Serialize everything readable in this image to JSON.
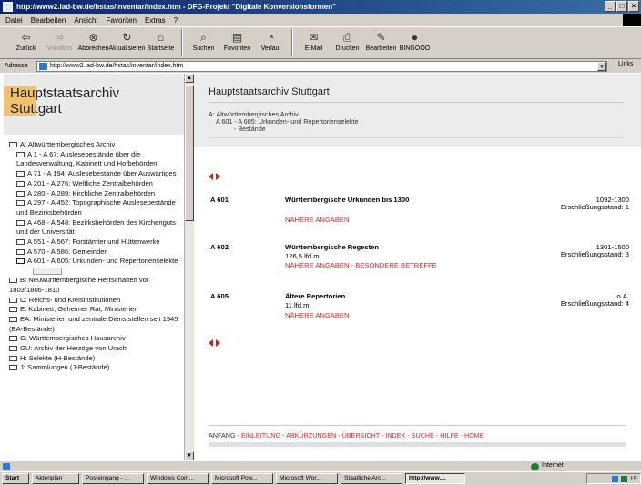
{
  "window": {
    "title": "http://www2.lad-bw.de/hstas/inventar/index.htm - DFG-Projekt \"Digitale Konversionsformen\"",
    "buttons": [
      "_",
      "□",
      "×"
    ]
  },
  "menu": [
    "Datei",
    "Bearbeiten",
    "Ansicht",
    "Favoriten",
    "Extras",
    "?"
  ],
  "toolbar": {
    "buttons": [
      {
        "label": "Zurück",
        "icon": "back-arrow-icon",
        "glyph": "⇦",
        "enabled": true
      },
      {
        "label": "Vorwärts",
        "icon": "forward-arrow-icon",
        "glyph": "⇨",
        "enabled": false
      },
      {
        "label": "Abbrechen",
        "icon": "stop-icon",
        "glyph": "⊗",
        "enabled": true
      },
      {
        "label": "Aktualisieren",
        "icon": "refresh-icon",
        "glyph": "↻",
        "enabled": true
      },
      {
        "label": "Startseite",
        "icon": "home-icon",
        "glyph": "⌂",
        "enabled": true
      },
      {
        "label": "Suchen",
        "icon": "search-icon",
        "glyph": "⌕",
        "enabled": true
      },
      {
        "label": "Favoriten",
        "icon": "favorites-icon",
        "glyph": "▤",
        "enabled": true
      },
      {
        "label": "Verlauf",
        "icon": "history-icon",
        "glyph": "◔",
        "enabled": true
      },
      {
        "label": "E-Mail",
        "icon": "mail-icon",
        "glyph": "✉",
        "enabled": true
      },
      {
        "label": "Drucken",
        "icon": "print-icon",
        "glyph": "⎙",
        "enabled": true
      },
      {
        "label": "Bearbeiten",
        "icon": "edit-icon",
        "glyph": "✎",
        "enabled": true
      },
      {
        "label": "BINGOOO",
        "icon": "bingooo-icon",
        "glyph": "●",
        "enabled": true
      }
    ]
  },
  "address": {
    "label": "Adresse",
    "url": "http://www2.lad-bw.de/hstas/inventar/index.htm",
    "links": "Links"
  },
  "left": {
    "banner": [
      "Hauptstaatsarchiv",
      "Stuttgart"
    ],
    "tree": [
      {
        "label": "A: Altwürttembergisches Archiv",
        "level": 0,
        "open": false
      },
      {
        "label": "A 1 - A 67: Auslesebestände über die Landesverwaltung, Kabinett und Hofbehörden",
        "level": 1,
        "open": false
      },
      {
        "label": "A 71 - A 194: Auslesebestände über Auswärtiges",
        "level": 1,
        "open": false
      },
      {
        "label": "A 201 - A 276: Weltliche Zentralbehörden",
        "level": 1,
        "open": false
      },
      {
        "label": "A 280 - A 289: Kirchliche Zentralbehörden",
        "level": 1,
        "open": false
      },
      {
        "label": "A 297 - A 452: Topographische Auslesebestände und Bezirksbehörden",
        "level": 1,
        "open": false
      },
      {
        "label": "A 468 - A 548: Bezirksbehörden des Kirchenguts und der Universität",
        "level": 1,
        "open": false
      },
      {
        "label": "A 551 - A 567: Forstämter und Hüttenwerke",
        "level": 1,
        "open": false
      },
      {
        "label": "A 570 - A 586: Gemeinden",
        "level": 1,
        "open": false
      },
      {
        "label": "A 601 - A 605: Urkunden- und Repertorienselekte",
        "level": 1,
        "open": true
      },
      {
        "label": "B: Neuwürttembergische Herrschaften vor 1803/1806-1810",
        "level": 0,
        "open": false
      },
      {
        "label": "C: Reichs- und Kreisinstitutionen",
        "level": 0,
        "open": false
      },
      {
        "label": "E: Kabinett, Geheimer Rat, Ministerien",
        "level": 0,
        "open": false
      },
      {
        "label": "EA: Ministerien und zentrale Dienststellen seit 1945 (EA-Bestände)",
        "level": 0,
        "open": false
      },
      {
        "label": "G: Württembergisches Hausarchiv",
        "level": 0,
        "open": false
      },
      {
        "label": "GU: Archiv der Herzöge von Urach",
        "level": 0,
        "open": false
      },
      {
        "label": "H: Selekte (H-Bestände)",
        "level": 0,
        "open": false
      },
      {
        "label": "J: Sammlungen (J-Bestände)",
        "level": 0,
        "open": false
      }
    ]
  },
  "right": {
    "title": "Hauptstaatsarchiv Stuttgart",
    "breadcrumb": [
      "A: Altwürttembergisches Archiv",
      "A 601 - A 605: Urkunden- und Repertorienselekte",
      "- Bestände"
    ],
    "records": [
      {
        "sig": "A 601",
        "title": "Württembergische Urkunden bis 1300",
        "extent": "",
        "links": "NÄHERE ANGABEN",
        "dates": "1092-1300",
        "state": "Erschließungsstand: 1"
      },
      {
        "sig": "A 602",
        "title": "Württembergische Regesten",
        "extent": "126,5 lfd.m",
        "links": "NÄHERE ANGABEN - BESONDERE BETREFFE",
        "dates": "1301-1500",
        "state": "Erschließungsstand: 3"
      },
      {
        "sig": "A 605",
        "title": "Ältere Repertorien",
        "extent": "11 lfd.m",
        "links": "NÄHERE ANGABEN",
        "dates": "o.A.",
        "state": "Erschließungsstand: 4"
      }
    ],
    "footer": {
      "first": "ANFANG",
      "links": "EINLEITUNG - ABKÜRZUNGEN - ÜBERSICHT - INDEX - SUCHE - HILFE - HOME"
    }
  },
  "status": {
    "zone": "Internet"
  },
  "taskbar": {
    "start": "Start",
    "tasks": [
      "Aktenplan",
      "Posteingang - ...",
      "Windows Com...",
      "Microsoft Pow...",
      "Microsoft Wor...",
      "Staatliche Arc...",
      "http://www...."
    ],
    "active": 6,
    "time": "15:"
  }
}
